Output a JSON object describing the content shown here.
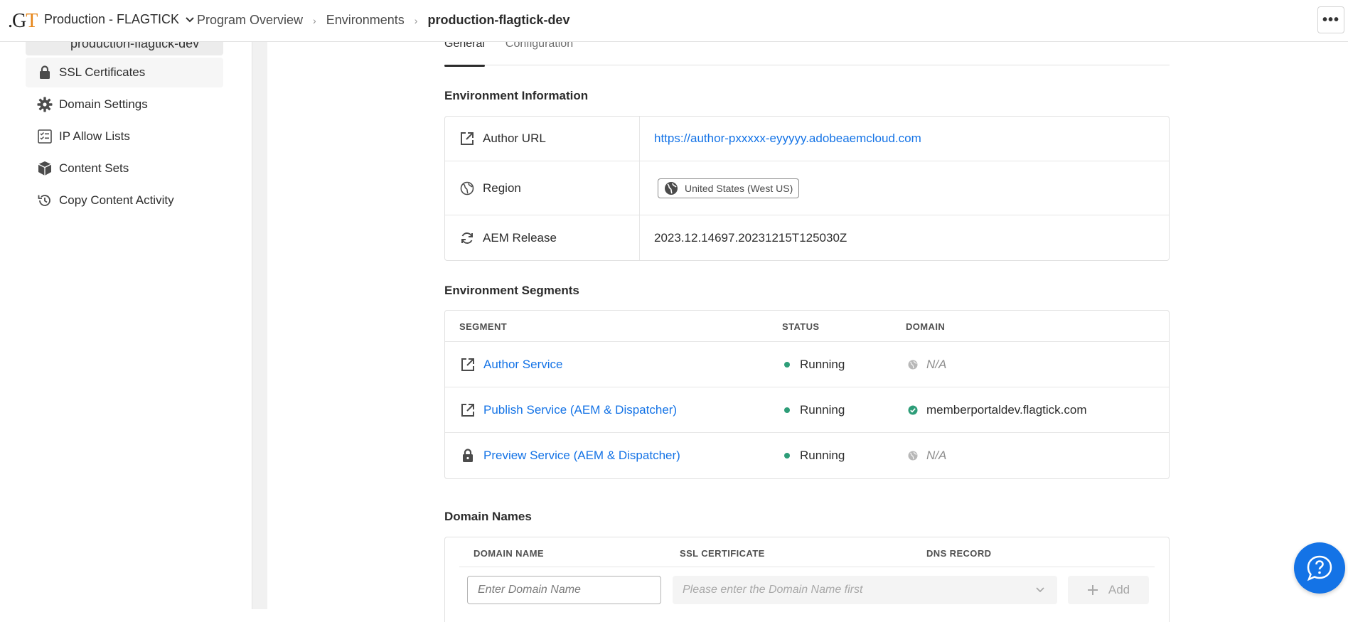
{
  "header": {
    "logo": {
      "a": "G",
      "b": "T"
    },
    "program": "Production - FLAGTICK",
    "breadcrumbs": [
      "Program Overview",
      "Environments"
    ],
    "current": "production-flagtick-dev",
    "more_label": "•••"
  },
  "sidebar": {
    "selected_label": "production-flagtick-dev",
    "items": [
      {
        "label": "SSL Certificates",
        "icon": "lock-icon"
      },
      {
        "label": "Domain Settings",
        "icon": "gear-icon"
      },
      {
        "label": "IP Allow Lists",
        "icon": "checklist-icon"
      },
      {
        "label": "Content Sets",
        "icon": "boxes-icon"
      },
      {
        "label": "Copy Content Activity",
        "icon": "history-icon"
      }
    ]
  },
  "tabs": [
    {
      "label": "General",
      "active": true
    },
    {
      "label": "Configuration",
      "active": false
    }
  ],
  "env_info": {
    "title": "Environment Information",
    "rows": [
      {
        "label": "Author URL",
        "value": "https://author-pxxxxx-eyyyyy.adobeaemcloud.com",
        "icon": "external-link-icon"
      },
      {
        "label": "Region",
        "value": "United States (West US)",
        "icon": "globe-icon"
      },
      {
        "label": "AEM Release",
        "value": "2023.12.14697.20231215T125030Z",
        "icon": "refresh-icon"
      }
    ]
  },
  "segments": {
    "title": "Environment Segments",
    "columns": [
      "SEGMENT",
      "STATUS",
      "DOMAIN"
    ],
    "rows": [
      {
        "name": "Author Service",
        "status": "Running",
        "domain": "N/A",
        "icon": "external-link-icon",
        "domain_icon": "globe-icon"
      },
      {
        "name": "Publish Service (AEM & Dispatcher)",
        "status": "Running",
        "domain": "memberportaldev.flagtick.com",
        "icon": "external-link-icon",
        "domain_icon": "check-circle-icon"
      },
      {
        "name": "Preview Service (AEM & Dispatcher)",
        "status": "Running",
        "domain": "N/A",
        "icon": "lock-icon",
        "domain_icon": "globe-icon"
      }
    ]
  },
  "domain_names": {
    "title": "Domain Names",
    "columns": [
      "DOMAIN NAME",
      "SSL CERTIFICATE",
      "DNS RECORD"
    ],
    "input_placeholder": "Enter Domain Name",
    "select_placeholder": "Please enter the Domain Name first",
    "add_label": "Add"
  },
  "colors": {
    "accent": "#1473e6",
    "running": "#2d9d78",
    "logo_orange": "#e68619"
  }
}
